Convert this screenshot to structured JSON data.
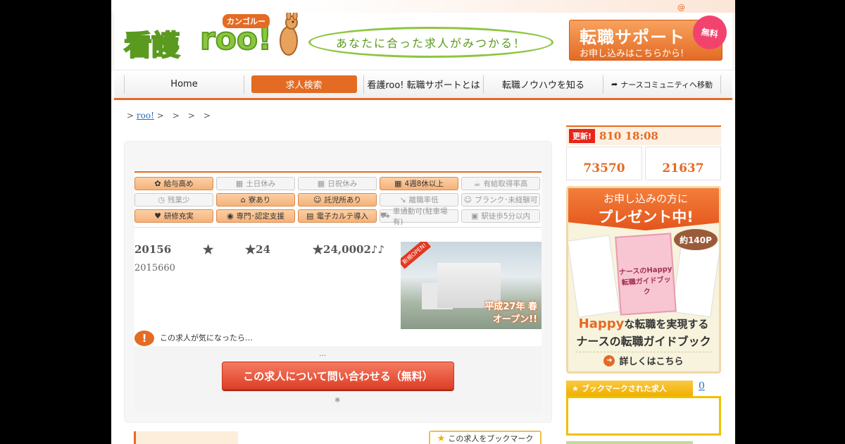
{
  "header": {
    "at_symbol": "@",
    "logo": {
      "main": "看護",
      "roo": "roo!",
      "kana": "カンゴルー"
    },
    "tagline": "あなたに合った求人がみつかる！",
    "support_banner": {
      "title": "転職サポート",
      "subtitle": "お申し込みはこちらから!",
      "badge": "無料"
    }
  },
  "nav": {
    "items": [
      {
        "label": "Home"
      },
      {
        "label": "求人検索"
      },
      {
        "label": "看護roo! 転職サポートとは"
      },
      {
        "label": "転職ノウハウを知る"
      },
      {
        "label": "ナースコミュニティへ移動"
      }
    ]
  },
  "breadcrumb": {
    "sep": ">",
    "link": "roo!",
    "rest": " >　>　>　>"
  },
  "tags": [
    {
      "label": "給与高め",
      "on": true,
      "icon": "✿"
    },
    {
      "label": "土日休み",
      "on": false,
      "icon": "▦"
    },
    {
      "label": "日祝休み",
      "on": false,
      "icon": "▦"
    },
    {
      "label": "4週8休以上",
      "on": true,
      "icon": "▦"
    },
    {
      "label": "有給取得率高",
      "on": false,
      "icon": "☕"
    },
    {
      "label": "残業少",
      "on": false,
      "icon": "◷"
    },
    {
      "label": "寮あり",
      "on": true,
      "icon": "⌂"
    },
    {
      "label": "託児所あり",
      "on": true,
      "icon": "☺"
    },
    {
      "label": "離職率低",
      "on": false,
      "icon": "↘"
    },
    {
      "label": "ブランク･未経験可",
      "on": false,
      "icon": "☺"
    },
    {
      "label": "研修充実",
      "on": true,
      "icon": "♥"
    },
    {
      "label": "専門･認定支援",
      "on": true,
      "icon": "◉"
    },
    {
      "label": "電子カルテ導入",
      "on": true,
      "icon": "▤"
    },
    {
      "label": "車通勤可(駐車場有)",
      "on": false,
      "icon": "⛟"
    },
    {
      "label": "駅徒歩5分以内",
      "on": false,
      "icon": "▣"
    }
  ],
  "job": {
    "title": "20156　　　★　　　★24　　　　★24,0002♪♪",
    "subtitle": "2015660",
    "photo": {
      "ribbon": "新規OPEN!",
      "label_l1": "平成27年 春",
      "label_l2": "オープン!!"
    }
  },
  "cta": {
    "question": "この求人が気になったら…",
    "ellipsis": "…",
    "button": "この求人について問い合わせる（無料）",
    "note": "※",
    "bookmark": "この求人をブックマーク"
  },
  "sidebar": {
    "update_badge": "更新!",
    "update_text": "810 18:08",
    "stats": [
      "73570",
      "21637"
    ],
    "present": {
      "head_l1": "お申し込みの方に",
      "head_l2": "プレゼント中!",
      "pages": "約140P",
      "book_title": "ナースのHappy転職ガイドブック",
      "line1_hp": "Happy",
      "line1_rest": "な転職を実現する",
      "line2": "ナースの転職ガイドブック",
      "more": "詳しくはこちら"
    },
    "bookmarks": {
      "title": "ブックマークされた求人",
      "count": "0"
    }
  },
  "colors": {
    "accent": "#e46b23",
    "green": "#8cc63f",
    "cta_red": "#dd3f26",
    "gold": "#f0b000"
  }
}
